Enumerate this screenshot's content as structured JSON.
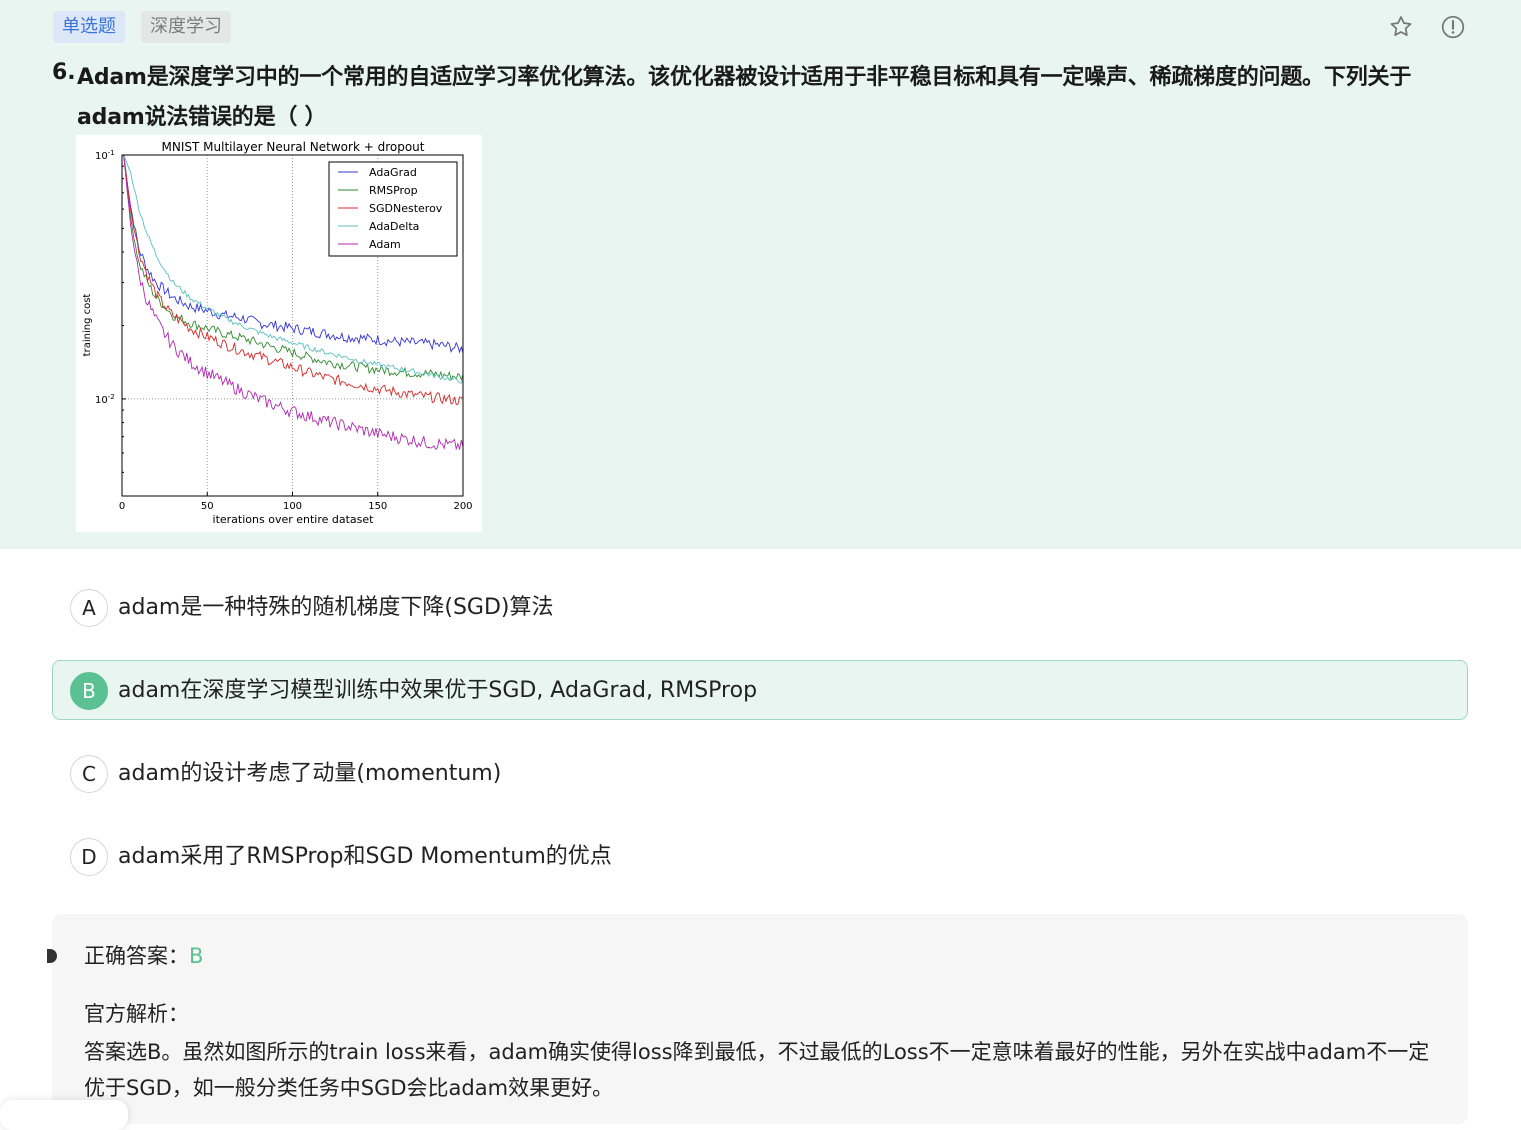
{
  "question": {
    "type_tag": "单选题",
    "subject_tag": "深度学习",
    "number": "6.",
    "text": "Adam是深度学习中的一个常用的自适应学习率优化算法。该优化器被设计适用于非平稳目标和具有一定噪声、稀疏梯度的问题。下列关于adam说法错误的是（ ）",
    "icons": {
      "favorite": "star-icon",
      "report": "exclamation-circle-icon"
    }
  },
  "chart_data": {
    "type": "line",
    "title": "MNIST Multilayer Neural Network + dropout",
    "xlabel": "iterations over entire dataset",
    "ylabel": "training cost",
    "xlim": [
      0,
      200
    ],
    "ylim": [
      0.004,
      0.1
    ],
    "yscale": "log",
    "grid": true,
    "legend_position": "top-right",
    "x_ticks": [
      "0",
      "50",
      "100",
      "150",
      "200"
    ],
    "y_ticks": [
      {
        "value": 0.1,
        "base": "10",
        "exp": "-1"
      },
      {
        "value": 0.01,
        "base": "10",
        "exp": "-2"
      }
    ],
    "x": [
      1,
      5,
      10,
      15,
      20,
      25,
      30,
      40,
      50,
      60,
      70,
      80,
      90,
      100,
      110,
      120,
      130,
      140,
      150,
      160,
      170,
      180,
      190,
      200
    ],
    "series": [
      {
        "name": "AdaGrad",
        "color": "#3535d6",
        "noise": 0.05,
        "values": [
          0.1,
          0.062,
          0.041,
          0.034,
          0.03,
          0.028,
          0.026,
          0.024,
          0.023,
          0.022,
          0.0215,
          0.0205,
          0.02,
          0.0195,
          0.019,
          0.0185,
          0.018,
          0.0178,
          0.0175,
          0.0172,
          0.017,
          0.0168,
          0.0165,
          0.016
        ]
      },
      {
        "name": "RMSProp",
        "color": "#2f8a2f",
        "noise": 0.045,
        "values": [
          0.1,
          0.055,
          0.036,
          0.03,
          0.026,
          0.024,
          0.022,
          0.0205,
          0.0195,
          0.0185,
          0.0178,
          0.017,
          0.0162,
          0.0155,
          0.0148,
          0.0142,
          0.0138,
          0.0135,
          0.0132,
          0.013,
          0.0128,
          0.0127,
          0.0125,
          0.0123
        ]
      },
      {
        "name": "SGDNesterov",
        "color": "#d62828",
        "noise": 0.05,
        "values": [
          0.1,
          0.06,
          0.04,
          0.032,
          0.027,
          0.024,
          0.022,
          0.0195,
          0.018,
          0.0168,
          0.0158,
          0.015,
          0.0142,
          0.0135,
          0.0128,
          0.0122,
          0.0118,
          0.0114,
          0.011,
          0.0107,
          0.0104,
          0.0102,
          0.01,
          0.0098
        ]
      },
      {
        "name": "AdaDelta",
        "color": "#5cc0c0",
        "noise": 0.025,
        "values": [
          0.1,
          0.085,
          0.06,
          0.047,
          0.039,
          0.034,
          0.03,
          0.026,
          0.0235,
          0.0215,
          0.02,
          0.0188,
          0.0178,
          0.017,
          0.0162,
          0.0155,
          0.0149,
          0.0143,
          0.0138,
          0.0134,
          0.013,
          0.0126,
          0.0122,
          0.0118
        ]
      },
      {
        "name": "Adam",
        "color": "#b02ab0",
        "noise": 0.06,
        "values": [
          0.1,
          0.052,
          0.032,
          0.025,
          0.021,
          0.0185,
          0.0165,
          0.0142,
          0.0128,
          0.0117,
          0.0108,
          0.01,
          0.0094,
          0.0089,
          0.0085,
          0.0081,
          0.0078,
          0.0075,
          0.0072,
          0.007,
          0.0068,
          0.0066,
          0.0065,
          0.0064
        ]
      }
    ]
  },
  "options": [
    {
      "letter": "A",
      "text": "adam是一种特殊的随机梯度下降(SGD)算法",
      "selected": false
    },
    {
      "letter": "B",
      "text": "adam在深度学习模型训练中效果优于SGD, AdaGrad, RMSProp",
      "selected": true
    },
    {
      "letter": "C",
      "text": "adam的设计考虑了动量(momentum)",
      "selected": false
    },
    {
      "letter": "D",
      "text": "adam采用了RMSProp和SGD Momentum的优点",
      "selected": false
    }
  ],
  "answer": {
    "label": "正确答案：",
    "value": "B",
    "explanation_title": "官方解析：",
    "explanation": "答案选B。虽然如图所示的train loss来看，adam确实使得loss降到最低，不过最低的Loss不一定意味着最好的性能，另外在实战中adam不一定优于SGD，如一般分类任务中SGD会比adam效果更好。"
  }
}
